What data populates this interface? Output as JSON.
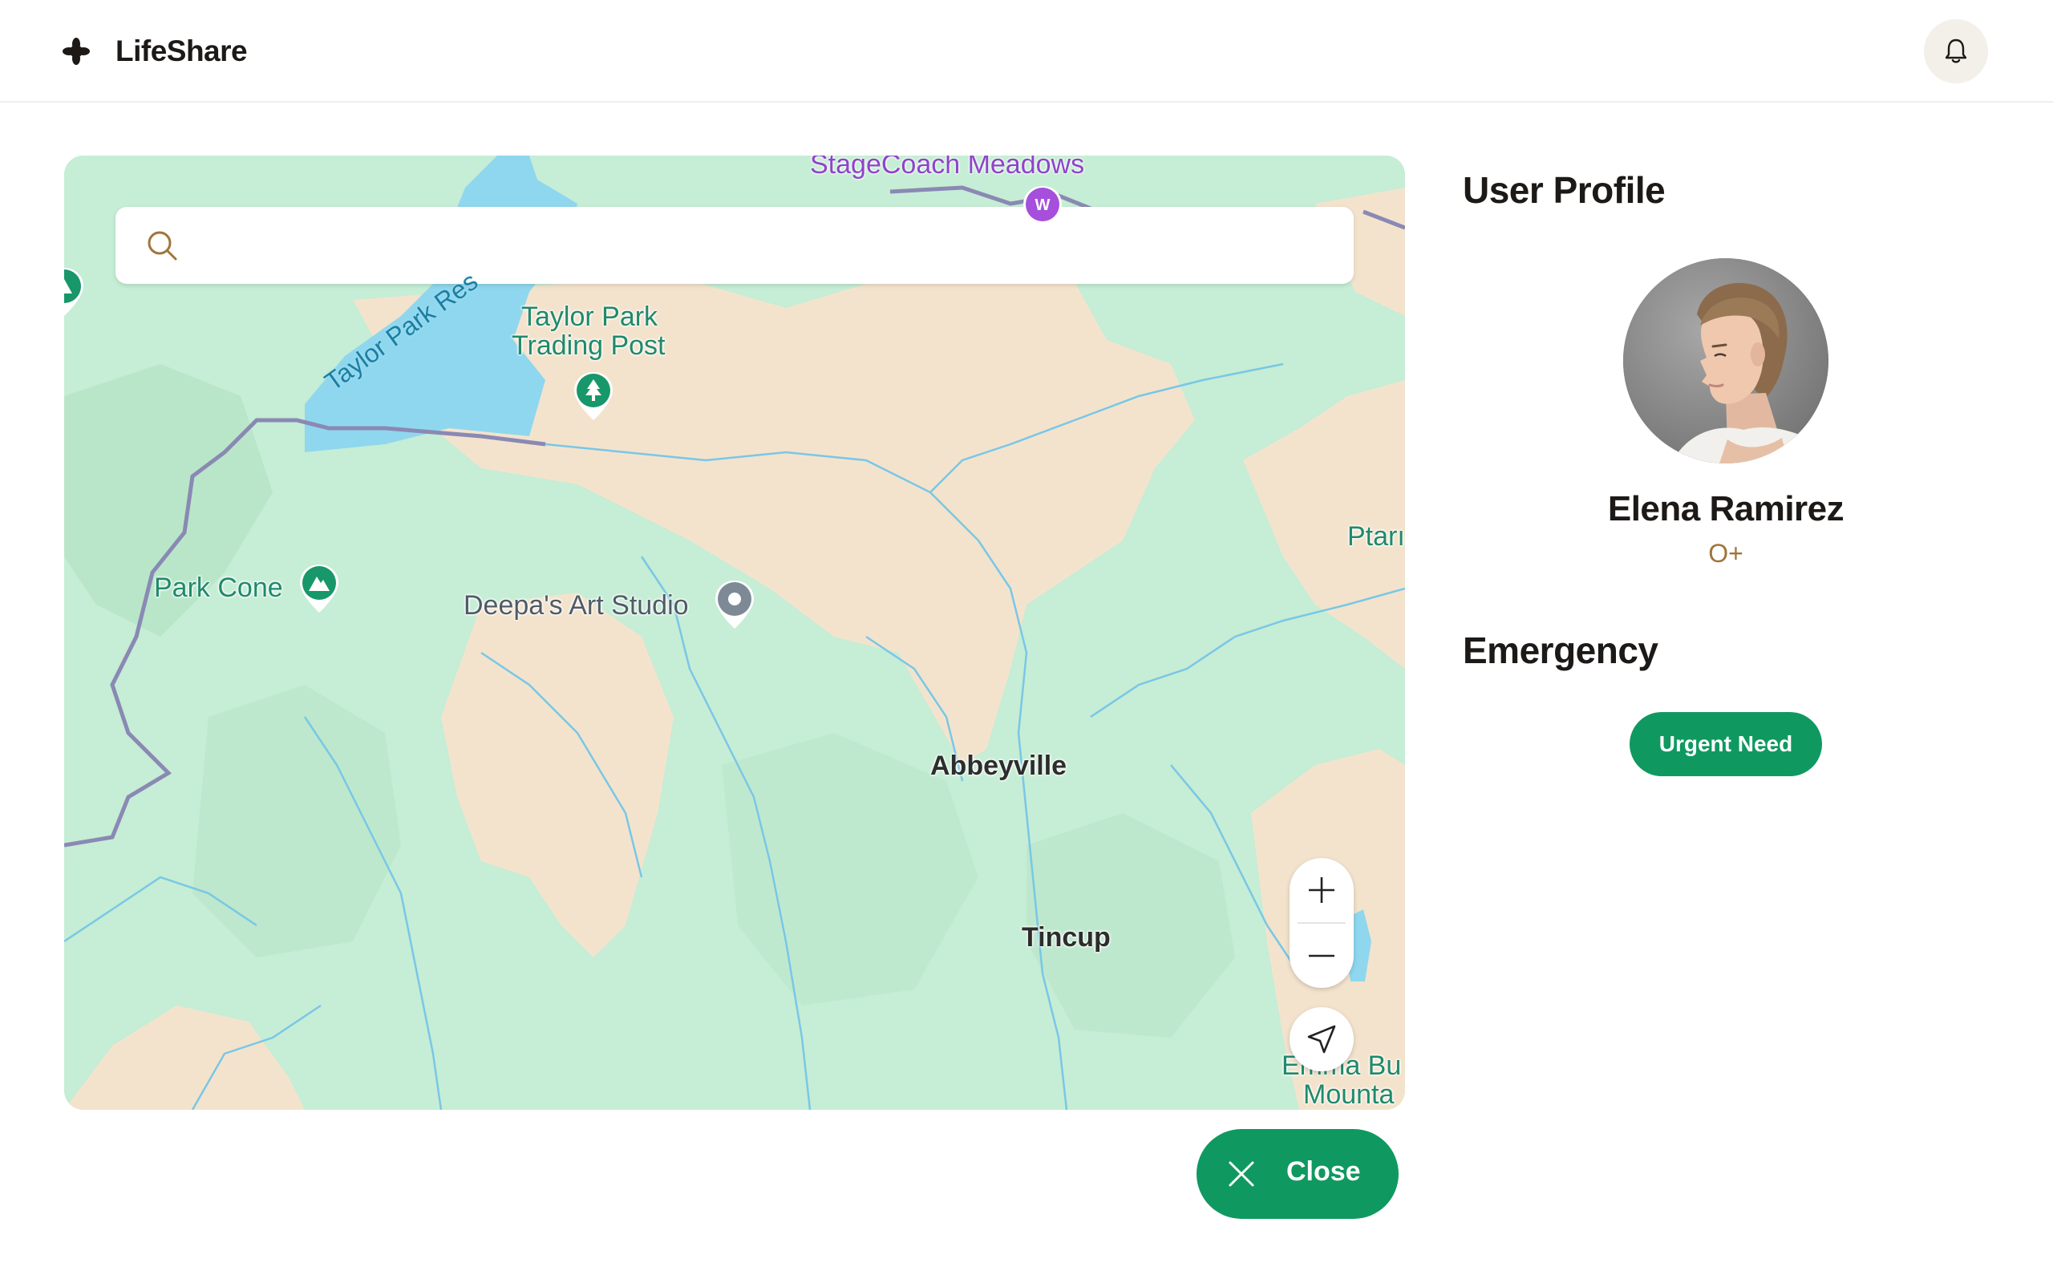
{
  "app": {
    "name": "LifeShare",
    "logo_icon": "asterisk-icon",
    "notification_icon": "bell-icon"
  },
  "map": {
    "search": {
      "placeholder": "",
      "value": "",
      "icon": "search-icon"
    },
    "labels": {
      "stagecoach": "StageCoach Meadows",
      "reservoir": "Taylor Park Res",
      "trading_post_line1": "Taylor Park",
      "trading_post_line2": "Trading Post",
      "park_cone": "Park Cone",
      "art_studio": "Deepa's Art Studio",
      "abbeyville": "Abbeyville",
      "tincup": "Tincup",
      "ptarmigan": "Ptarı",
      "emma_line1": "Emma Bu",
      "emma_line2": "Mounta"
    },
    "controls": {
      "zoom_in_icon": "plus-icon",
      "zoom_out_icon": "minus-icon",
      "locate_icon": "navigation-arrow-icon"
    }
  },
  "close_button": {
    "label": "Close",
    "icon": "close-icon"
  },
  "profile": {
    "section_title": "User Profile",
    "name": "Elena Ramirez",
    "blood_type": "O+"
  },
  "emergency": {
    "section_title": "Emergency",
    "button_label": "Urgent Need"
  },
  "colors": {
    "primary_green": "#0f9960",
    "map_forest": "#c9eed6",
    "map_land": "#f3e3cd",
    "map_water": "#8fd7ee",
    "blood_type_accent": "#a0753a"
  }
}
